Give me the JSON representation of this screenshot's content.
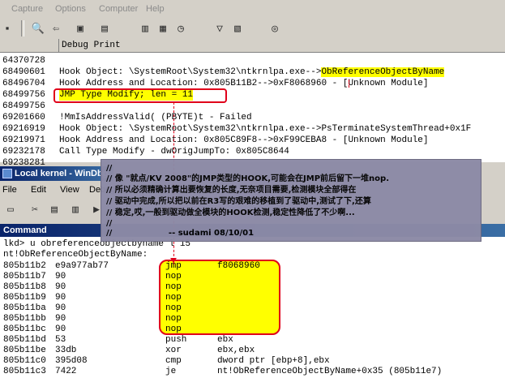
{
  "menu": [
    "Capture",
    "Options",
    "Computer",
    "Help"
  ],
  "debug_view": {
    "col_time": "",
    "col_print": "Debug Print",
    "rows": [
      {
        "t": "64370728",
        "m": ""
      },
      {
        "t": "68490601",
        "m": "Hook Object: \\SystemRoot\\System32\\ntkrnlpa.exe-->",
        "m2": "ObReferenceObjectByName"
      },
      {
        "t": "68496704",
        "m": "Hook Address and Location: 0x805B11B2-->0xF8068960 - [Unknown Module]"
      },
      {
        "t": "68499756",
        "m": "JMP Type Modify; len = 11"
      },
      {
        "t": "68499756",
        "m": ""
      },
      {
        "t": "69201660",
        "m": "!MmIsAddressValid( (PBYTE)t - Failed"
      },
      {
        "t": "69216919",
        "m": "Hook Object: \\SystemRoot\\System32\\ntkrnlpa.exe-->PsTerminateSystemThread+0x1F"
      },
      {
        "t": "69219971",
        "m": "Hook Address and Location: 0x805C89F8-->0xF99CEBA8 - [Unknown Module]"
      },
      {
        "t": "69232178",
        "m": "Call Type Modify - dwOrigJumpTo: 0x805C8644"
      },
      {
        "t": "69238281",
        "m": ""
      }
    ]
  },
  "kernel_window": {
    "title": "Local kernel - WinDbg",
    "menu": [
      "File",
      "Edit",
      "View",
      "Debug"
    ]
  },
  "command": {
    "title": "Command",
    "prompt": "lkd> u obreferenceobjectbyname l 15",
    "symbol": "nt!ObReferenceObjectByName:",
    "rows": [
      {
        "addr": "805b11b2",
        "bytes": "e9a977ab77",
        "op": "jmp",
        "arg": "f8068960"
      },
      {
        "addr": "805b11b7",
        "bytes": "90",
        "op": "nop",
        "arg": ""
      },
      {
        "addr": "805b11b8",
        "bytes": "90",
        "op": "nop",
        "arg": ""
      },
      {
        "addr": "805b11b9",
        "bytes": "90",
        "op": "nop",
        "arg": ""
      },
      {
        "addr": "805b11ba",
        "bytes": "90",
        "op": "nop",
        "arg": ""
      },
      {
        "addr": "805b11bb",
        "bytes": "90",
        "op": "nop",
        "arg": ""
      },
      {
        "addr": "805b11bc",
        "bytes": "90",
        "op": "nop",
        "arg": ""
      },
      {
        "addr": "805b11bd",
        "bytes": "53",
        "op": "push",
        "arg": "ebx"
      },
      {
        "addr": "805b11be",
        "bytes": "33db",
        "op": "xor",
        "arg": "ebx,ebx"
      },
      {
        "addr": "805b11c0",
        "bytes": "395d08",
        "op": "cmp",
        "arg": "dword ptr [ebp+8],ebx"
      },
      {
        "addr": "805b11c3",
        "bytes": "7422",
        "op": "je",
        "arg": "nt!ObReferenceObjectByName+0x35 (805b11e7)"
      }
    ]
  },
  "comment_lines": [
    "//",
    "// 像 \"就点/KV 2008\"的JMP类型的HOOK,可能会在JMP前后留下一堆nop.",
    "// 所以必须精确计算出要恢复的长度,无奈项目需要,检测模块全部得在",
    "// 驱动中完成,所以把以前在R3写的艰难的移植到了驱动中,测试了下,还算",
    "// 稳定,哎,一般到驱动做全模块的HOOK检测,稳定性降低了不少啊...",
    "//",
    "//                    -- sudami 08/10/01"
  ],
  "colors": {
    "highlight": "#ffff00",
    "callout": "#e0001a",
    "titlebar": "#0a246a"
  }
}
